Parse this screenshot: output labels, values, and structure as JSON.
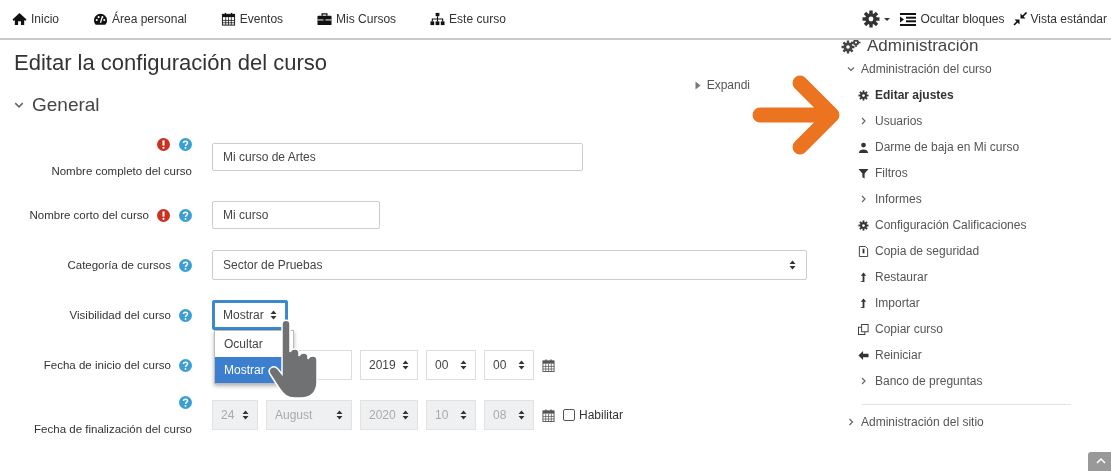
{
  "nav": {
    "items": [
      {
        "label": "Inicio"
      },
      {
        "label": "Área personal"
      },
      {
        "label": "Eventos"
      },
      {
        "label": "Mis Cursos"
      },
      {
        "label": "Este curso"
      }
    ],
    "right": [
      {
        "label": "Ocultar bloques"
      },
      {
        "label": "Vista estándar"
      }
    ]
  },
  "page_title": "Editar la configuración del curso",
  "expand_all": "Expandi",
  "section": {
    "title": "General",
    "expanded": true
  },
  "fields": [
    {
      "kind": "text",
      "label": "Nombre completo del curso",
      "required": true,
      "value": "Mi curso de Artes"
    },
    {
      "kind": "text",
      "label": "Nombre corto del curso",
      "required": true,
      "value": "Mi curso"
    },
    {
      "kind": "select",
      "label": "Categoría de cursos",
      "required": false,
      "value": "Sector de Pruebas"
    },
    {
      "kind": "select",
      "label": "Visibilidad del curso",
      "required": false,
      "value": "Mostrar",
      "focused": true,
      "options": [
        {
          "label": "Ocultar",
          "selected": false
        },
        {
          "label": "Mostrar",
          "selected": true
        }
      ]
    },
    {
      "kind": "date",
      "label": "Fecha de inicio del curso",
      "required": false,
      "disabled": false,
      "parts": [
        "2019",
        "00",
        "00"
      ]
    },
    {
      "kind": "date",
      "label": "Fecha de finalización del curso",
      "required": false,
      "disabled": true,
      "parts": [
        "24",
        "August",
        "2020",
        "10",
        "08"
      ],
      "enable": {
        "label": "Habilitar",
        "checked": false
      }
    }
  ],
  "admin": {
    "title": "Administración",
    "tree": [
      {
        "label": "Administración del curso",
        "kind": "node",
        "expanded": true,
        "children": [
          {
            "label": "Editar ajustes",
            "kind": "leaf",
            "selected": true
          },
          {
            "label": "Usuarios",
            "kind": "node",
            "expanded": false,
            "selected": false
          },
          {
            "label": "Darme de baja en Mi curso",
            "kind": "leaf",
            "selected": false
          },
          {
            "label": "Filtros",
            "kind": "leaf",
            "selected": false
          },
          {
            "label": "Informes",
            "kind": "node",
            "expanded": false,
            "selected": false
          },
          {
            "label": "Configuración Calificaciones",
            "kind": "leaf",
            "selected": false
          },
          {
            "label": "Copia de seguridad",
            "kind": "leaf",
            "selected": false
          },
          {
            "label": "Restaurar",
            "kind": "leaf",
            "selected": false
          },
          {
            "label": "Importar",
            "kind": "leaf",
            "selected": false
          },
          {
            "label": "Copiar curso",
            "kind": "leaf",
            "selected": false
          },
          {
            "label": "Reiniciar",
            "kind": "leaf",
            "selected": false
          },
          {
            "label": "Banco de preguntas",
            "kind": "node",
            "expanded": false,
            "selected": false
          }
        ]
      },
      {
        "label": "Administración del sitio",
        "kind": "node",
        "expanded": false
      }
    ]
  }
}
